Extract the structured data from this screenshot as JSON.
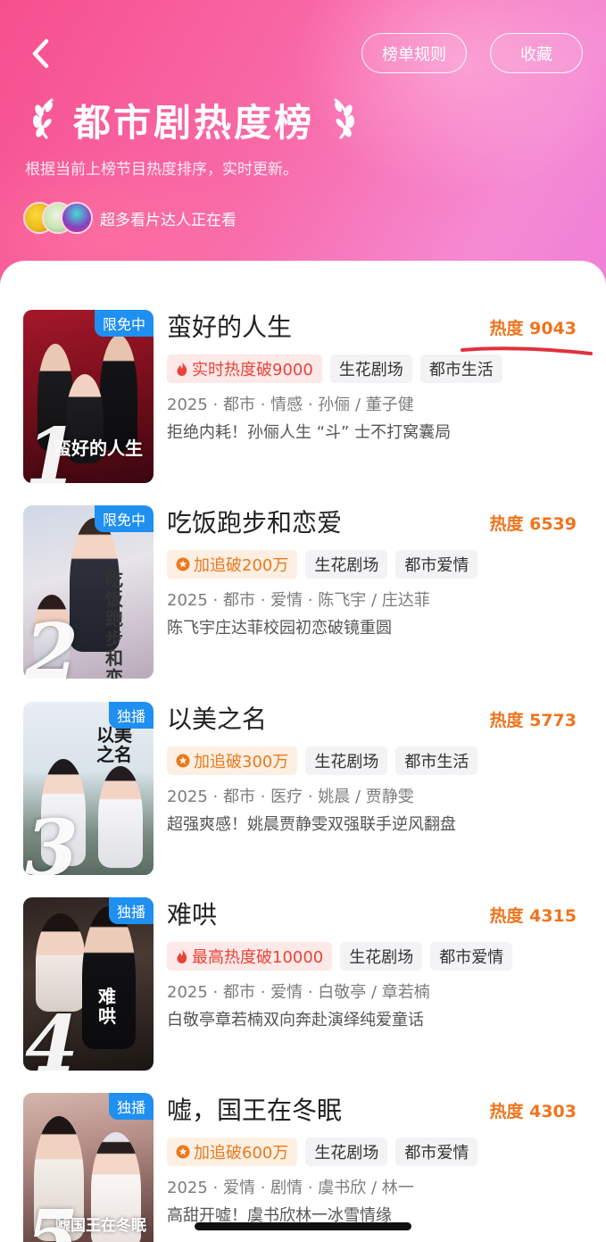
{
  "header": {
    "back_icon": "chevron-left-icon",
    "rules_label": "榜单规则",
    "fav_label": "收藏",
    "title": "都市剧热度榜",
    "subtitle": "根据当前上榜节目热度排序，实时更新。",
    "watchers_text": "超多看片达人正在看"
  },
  "list": [
    {
      "rank": "1",
      "badge": "限免中",
      "poster_title": "蛮好的人生",
      "title": "蛮好的人生",
      "heat": "热度 9043",
      "highlight_tag": "实时热度破9000",
      "highlight_icon": "flame-icon",
      "highlight_style": "red",
      "tags": [
        "生花剧场",
        "都市生活"
      ],
      "meta": "2025 · 都市 · 情感 · 孙俪 / 董子健",
      "desc": "拒绝内耗！孙俪人生 “斗” 士不打窝囊局"
    },
    {
      "rank": "2",
      "badge": "限免中",
      "poster_title": "吃饭跑步和恋爱",
      "title": "吃饭跑步和恋爱",
      "heat": "热度 6539",
      "highlight_tag": "加追破200万",
      "highlight_icon": "star-badge-icon",
      "highlight_style": "orange",
      "tags": [
        "生花剧场",
        "都市爱情"
      ],
      "meta": "2025 · 都市 · 爱情 · 陈飞宇 / 庄达菲",
      "desc": "陈飞宇庄达菲校园初恋破镜重圆"
    },
    {
      "rank": "3",
      "badge": "独播",
      "poster_title": "以美之名",
      "title": "以美之名",
      "heat": "热度 5773",
      "highlight_tag": "加追破300万",
      "highlight_icon": "star-badge-icon",
      "highlight_style": "orange",
      "tags": [
        "生花剧场",
        "都市生活"
      ],
      "meta": "2025 · 都市 · 医疗 · 姚晨 / 贾静雯",
      "desc": "超强爽感！姚晨贾静雯双强联手逆风翻盘"
    },
    {
      "rank": "4",
      "badge": "独播",
      "poster_title": "难哄",
      "title": "难哄",
      "heat": "热度 4315",
      "highlight_tag": "最高热度破10000",
      "highlight_icon": "flame-icon",
      "highlight_style": "red",
      "tags": [
        "生花剧场",
        "都市爱情"
      ],
      "meta": "2025 · 都市 · 爱情 · 白敬亭 / 章若楠",
      "desc": "白敬亭章若楠双向奔赴演绎纯爱童话"
    },
    {
      "rank": "5",
      "badge": "独播",
      "poster_title": "嘘国王在冬眠",
      "title": "嘘，国王在冬眠",
      "heat": "热度 4303",
      "highlight_tag": "加追破600万",
      "highlight_icon": "star-badge-icon",
      "highlight_style": "orange",
      "tags": [
        "生花剧场",
        "都市爱情"
      ],
      "meta": "2025 · 爱情 · 剧情 · 虞书欣 / 林一",
      "desc": "高甜开嘘！虞书欣林一冰雪情缘"
    }
  ],
  "colors": {
    "heat": "#f0741d",
    "badge": "#1f8ff0",
    "red_tag": "#e8443a",
    "orange_tag": "#e8791e",
    "annotation": "#e0323c"
  }
}
